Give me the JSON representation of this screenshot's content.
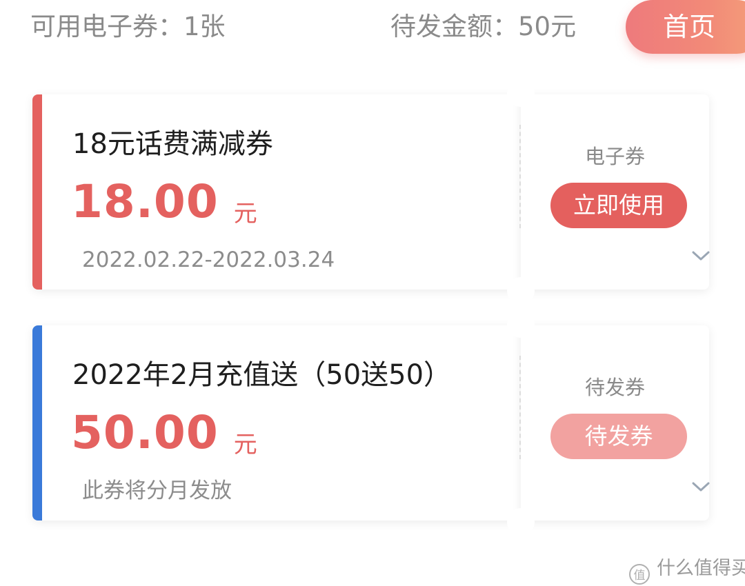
{
  "header": {
    "available_label": "可用电子券：1张",
    "pending_label": "待发金额：50元",
    "home_button": "首页"
  },
  "coupons": [
    {
      "title": "18元话费满减券",
      "amount": "18.00",
      "unit": "元",
      "subtitle": "2022.02.22-2022.03.24",
      "type_label": "电子券",
      "action_label": "立即使用",
      "accent_color": "#e4615f"
    },
    {
      "title": "2022年2月充值送（50送50）",
      "amount": "50.00",
      "unit": "元",
      "subtitle": "此券将分月发放",
      "type_label": "待发券",
      "action_label": "待发券",
      "accent_color": "#3a7ad9"
    }
  ],
  "watermark": {
    "text": "什么值得买",
    "logo_char": "值"
  }
}
